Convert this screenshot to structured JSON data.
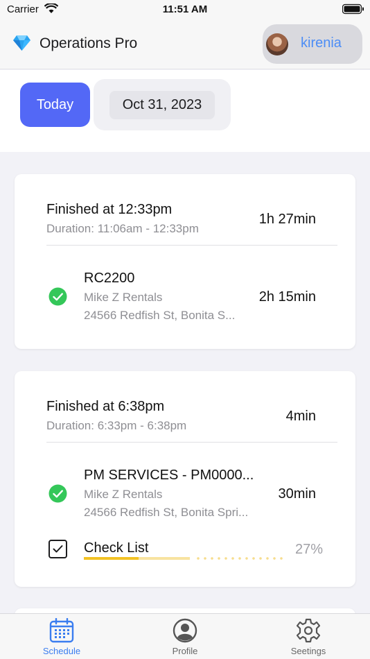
{
  "status_bar": {
    "carrier": "Carrier",
    "time": "11:51 AM"
  },
  "header": {
    "app_title": "Operations Pro",
    "user_name": "kirenia"
  },
  "date_bar": {
    "today_label": "Today",
    "selected_date": "Oct 31, 2023"
  },
  "visits": [
    {
      "finished_label": "Finished at 12:33pm",
      "duration_label": "Duration: 11:06am - 12:33pm",
      "total": "1h 27min",
      "job": {
        "name": "RC2200",
        "client": "Mike Z Rentals",
        "address": "24566 Redfish St, Bonita S...",
        "duration": "2h 15min",
        "status": "completed"
      }
    },
    {
      "finished_label": "Finished at 6:38pm",
      "duration_label": "Duration: 6:33pm - 6:38pm",
      "total": "4min",
      "job": {
        "name": "PM SERVICES - PM0000...",
        "client": "Mike Z Rentals",
        "address": "24566 Redfish St, Bonita Spri...",
        "duration": "30min",
        "status": "completed"
      },
      "checklist": {
        "label": "Check List",
        "percent_label": "27%",
        "progress": 0.27
      }
    }
  ],
  "tabs": [
    {
      "label": "Schedule",
      "icon": "calendar-icon",
      "active": true
    },
    {
      "label": "Profile",
      "icon": "person-circle-icon",
      "active": false
    },
    {
      "label": "Seetings",
      "icon": "gear-icon",
      "active": false
    }
  ],
  "colors": {
    "accent": "#5368f6",
    "link": "#4c8df6",
    "success": "#34c759",
    "progress": "#f2c224"
  }
}
